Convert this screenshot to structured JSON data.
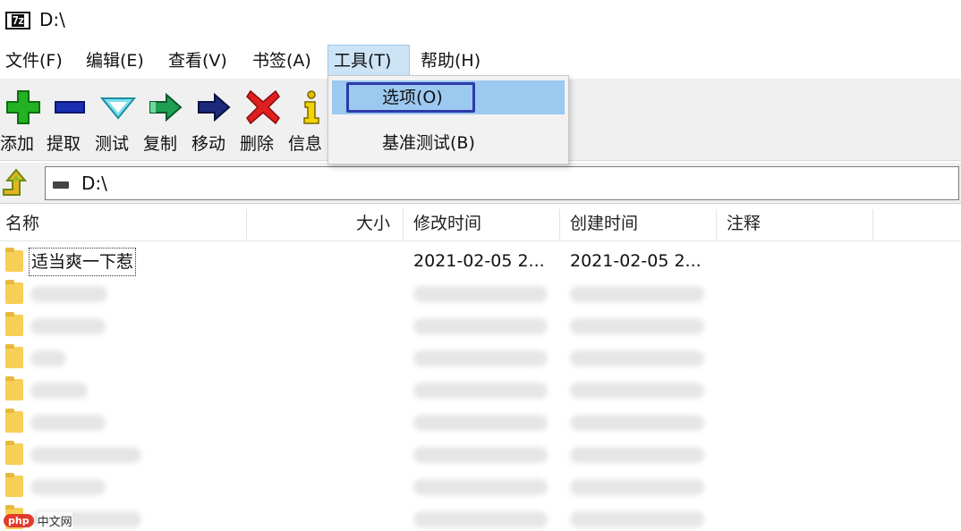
{
  "window": {
    "title": "D:\\",
    "app_icon": "7z"
  },
  "menubar": {
    "items": [
      "文件(F)",
      "编辑(E)",
      "查看(V)",
      "书签(A)",
      "工具(T)",
      "帮助(H)"
    ],
    "active": "工具(T)"
  },
  "toolbar": {
    "buttons": [
      {
        "label": "添加",
        "icon": "add-plus-icon",
        "color": "#1aa61a"
      },
      {
        "label": "提取",
        "icon": "extract-minus-icon",
        "color": "#1b2fb5"
      },
      {
        "label": "测试",
        "icon": "test-check-icon",
        "color": "#2db8c9"
      },
      {
        "label": "复制",
        "icon": "copy-arrow-icon",
        "color": "#1c8f4b"
      },
      {
        "label": "移动",
        "icon": "move-arrow-icon",
        "color": "#1b2a7a"
      },
      {
        "label": "删除",
        "icon": "delete-x-icon",
        "color": "#e02020"
      },
      {
        "label": "信息",
        "icon": "info-icon",
        "color": "#c9a500"
      }
    ]
  },
  "address": {
    "path": "D:\\"
  },
  "columns": [
    "名称",
    "大小",
    "修改时间",
    "创建时间",
    "注释"
  ],
  "rows": [
    {
      "name": "适当爽一下惹",
      "modified": "2021-02-05 2...",
      "created": "2021-02-05 2..."
    }
  ],
  "dropdown": {
    "items": [
      "选项(O)",
      "基准测试(B)"
    ],
    "highlighted": "选项(O)"
  },
  "watermark": {
    "badge": "php",
    "text": "中文网"
  }
}
